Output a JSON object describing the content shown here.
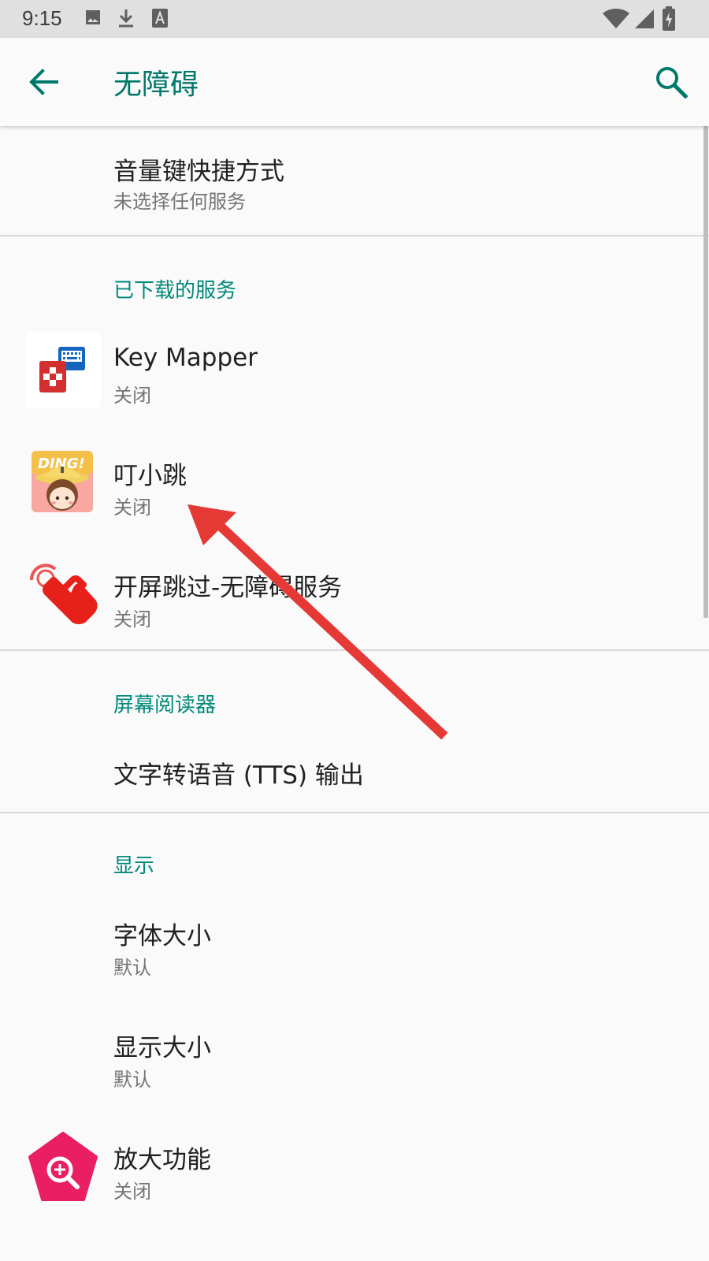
{
  "status_bar": {
    "time": "9:15",
    "left_icons": [
      "image-icon",
      "download-icon",
      "font-icon"
    ],
    "right_icons": [
      "wifi-icon",
      "signal-icon",
      "battery-charging-icon"
    ]
  },
  "app_bar": {
    "title": "无障碍",
    "back_icon": "arrow-back-icon",
    "search_icon": "search-icon"
  },
  "sections": {
    "shortcut": {
      "title": "音量键快捷方式",
      "subtitle": "未选择任何服务"
    },
    "downloaded": {
      "header": "已下载的服务",
      "items": [
        {
          "title": "Key Mapper",
          "subtitle": "关闭",
          "icon": "key-mapper-icon"
        },
        {
          "title": "叮小跳",
          "subtitle": "关闭",
          "icon": "ding-app-icon",
          "icon_text": "DING!"
        },
        {
          "title": "开屏跳过-无障碍服务",
          "subtitle": "关闭",
          "icon": "tap-hand-icon"
        }
      ]
    },
    "screen_reader": {
      "header": "屏幕阅读器",
      "items": [
        {
          "title": "文字转语音 (TTS) 输出"
        }
      ]
    },
    "display": {
      "header": "显示",
      "items": [
        {
          "title": "字体大小",
          "subtitle": "默认"
        },
        {
          "title": "显示大小",
          "subtitle": "默认"
        },
        {
          "title": "放大功能",
          "subtitle": "关闭",
          "icon": "magnification-icon"
        }
      ]
    }
  },
  "annotation": {
    "type": "arrow",
    "color": "#e53935"
  }
}
